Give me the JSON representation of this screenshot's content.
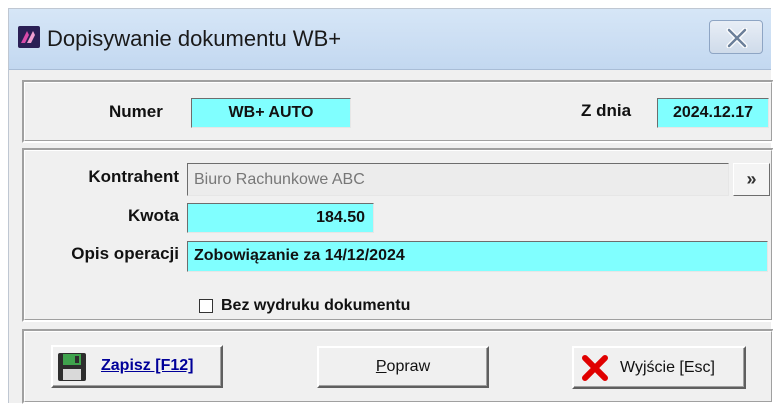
{
  "window": {
    "title": "Dopisywanie dokumentu WB+"
  },
  "header": {
    "numer_label": "Numer",
    "numer_value": "WB+ AUTO",
    "date_label": "Z dnia",
    "date_value": "2024.12.17"
  },
  "form": {
    "kontrahent_label": "Kontrahent",
    "kontrahent_value": "Biuro Rachunkowe ABC",
    "more_label": "»",
    "kwota_label": "Kwota",
    "kwota_value": "184.50",
    "opis_label": "Opis operacji",
    "opis_value": "Zobowiązanie za 14/12/2024",
    "no_print_label": "Bez wydruku dokumentu",
    "no_print_checked": false
  },
  "buttons": {
    "save_label": "Zapisz  [F12]",
    "fix_label_first": "P",
    "fix_label_rest": "opraw",
    "exit_label": "Wyjście  [Esc]"
  },
  "icons": {
    "app": "app-logo-icon",
    "close": "close-icon",
    "save": "floppy-disk-icon",
    "exit": "red-x-icon"
  },
  "colors": {
    "field_highlight": "#80ffff",
    "save_text": "#000099",
    "exit_icon": "#e00000"
  }
}
